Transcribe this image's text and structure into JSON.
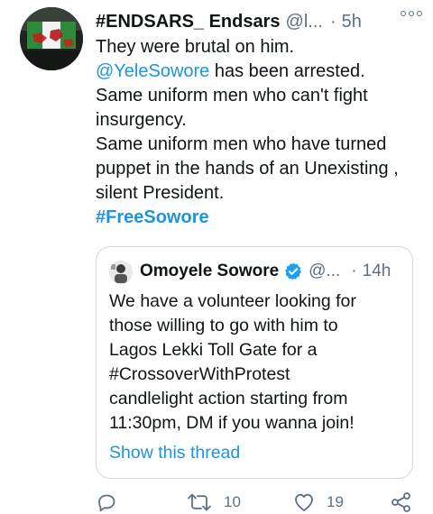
{
  "tweet": {
    "display_name": "#ENDSARS_ Endsars",
    "handle": "@l...",
    "separator": "·",
    "time": "5h",
    "body": {
      "line1": "They were brutal on him.",
      "mention": "@YeleSowore",
      "line2_rest": " has been arrested.",
      "line3": "Same uniform men who can't fight",
      "line4": "insurgency.",
      "line5": "Same uniform men who have turned",
      "line6": "puppet in the hands of an Unexisting ,",
      "line7": "silent President.",
      "hashtag": "#FreeSowore"
    }
  },
  "quote": {
    "display_name": "Omoyele Sowore",
    "handle": "@...",
    "separator": "·",
    "time": "14h",
    "body": {
      "line1": "We have a volunteer looking for",
      "line2": "those willing to go with him to",
      "line3": "Lagos Lekki Toll Gate for a",
      "line4": "#CrossoverWithProtest",
      "line5": "candlelight action starting from",
      "line6": "11:30pm, DM if you wanna join!"
    },
    "show_thread": "Show this thread"
  },
  "actions": {
    "reply_icon": "reply-icon",
    "retweet_icon": "retweet-icon",
    "retweet_count": "10",
    "like_icon": "heart-icon",
    "like_count": "19",
    "share_icon": "share-icon"
  },
  "colors": {
    "link": "#1b95e0",
    "muted": "#5b7083",
    "text": "#0f1419",
    "verified": "#1da1f2",
    "border": "#cfd9de"
  }
}
